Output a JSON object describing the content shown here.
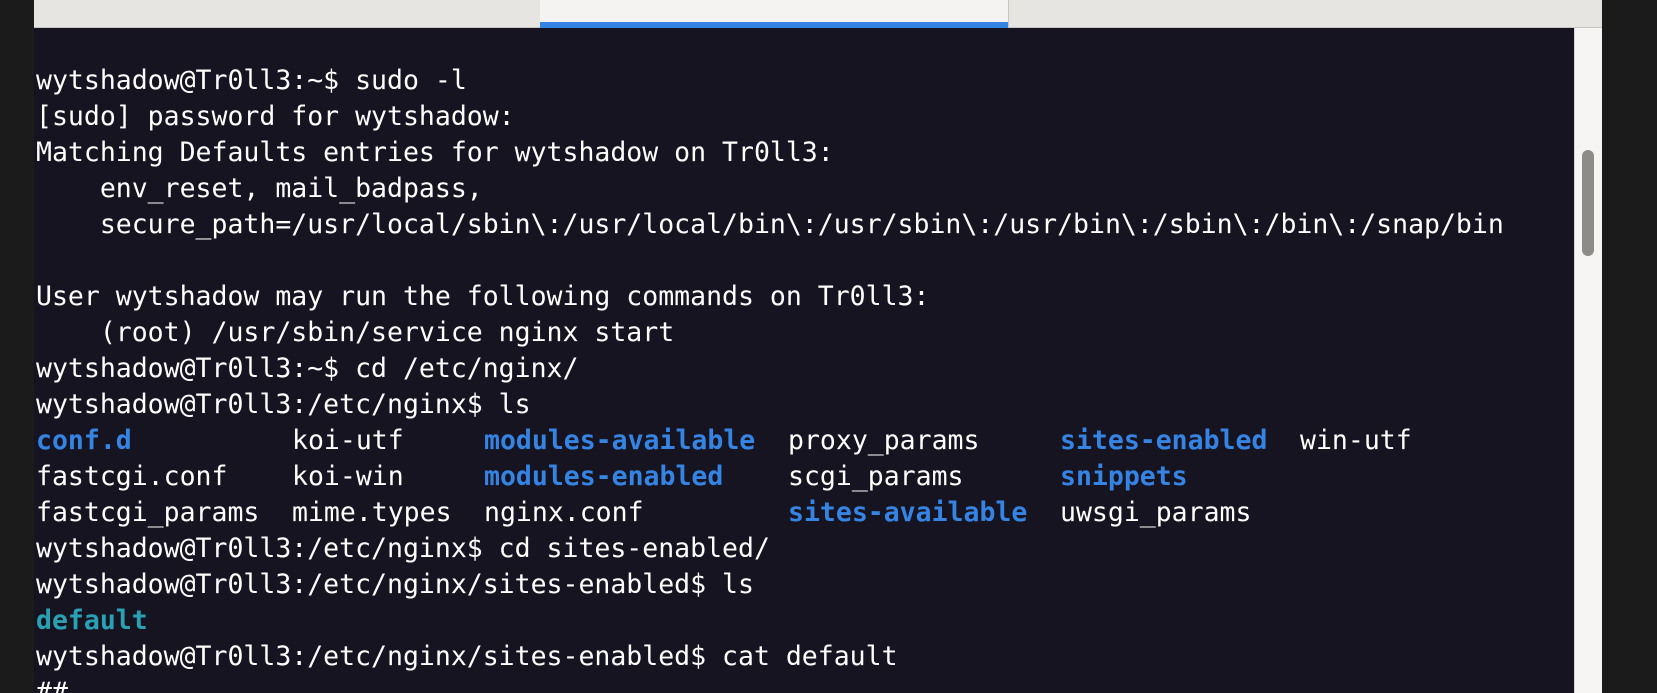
{
  "tabs": [
    {
      "label": "",
      "active": false
    },
    {
      "label": "",
      "active": true
    },
    {
      "label": "",
      "active": false
    }
  ],
  "colors": {
    "terminal_bg": "#171421",
    "text": "#ffffff",
    "directory": "#3584e4",
    "symlink": "#2aa1b3",
    "active_tab_indicator": "#3584e4"
  },
  "terminal": {
    "lines_before_ls": [
      "wytshadow@Tr0ll3:~$ sudo -l",
      "[sudo] password for wytshadow:",
      "Matching Defaults entries for wytshadow on Tr0ll3:",
      "    env_reset, mail_badpass,",
      "    secure_path=/usr/local/sbin\\:/usr/local/bin\\:/usr/sbin\\:/usr/bin\\:/sbin\\:/bin\\:/snap/bin",
      "",
      "User wytshadow may run the following commands on Tr0ll3:",
      "    (root) /usr/sbin/service nginx start",
      "wytshadow@Tr0ll3:~$ cd /etc/nginx/",
      "wytshadow@Tr0ll3:/etc/nginx$ ls"
    ],
    "ls_output": [
      [
        {
          "text": "conf.d",
          "type": "dir"
        },
        {
          "text": "koi-utf",
          "type": "file"
        },
        {
          "text": "modules-available",
          "type": "dir"
        },
        {
          "text": "proxy_params",
          "type": "file"
        },
        {
          "text": "sites-enabled",
          "type": "dir"
        },
        {
          "text": "win-utf",
          "type": "file"
        }
      ],
      [
        {
          "text": "fastcgi.conf",
          "type": "file"
        },
        {
          "text": "koi-win",
          "type": "file"
        },
        {
          "text": "modules-enabled",
          "type": "dir"
        },
        {
          "text": "scgi_params",
          "type": "file"
        },
        {
          "text": "snippets",
          "type": "dir"
        },
        {
          "text": "",
          "type": "file"
        }
      ],
      [
        {
          "text": "fastcgi_params",
          "type": "file"
        },
        {
          "text": "mime.types",
          "type": "file"
        },
        {
          "text": "nginx.conf",
          "type": "file"
        },
        {
          "text": "sites-available",
          "type": "dir"
        },
        {
          "text": "uwsgi_params",
          "type": "file"
        },
        {
          "text": "",
          "type": "file"
        }
      ]
    ],
    "line_cd_sites": "wytshadow@Tr0ll3:/etc/nginx$ cd sites-enabled/",
    "line_ls_sites": "wytshadow@Tr0ll3:/etc/nginx/sites-enabled$ ls",
    "sites_ls_output": "default",
    "line_cat": "wytshadow@Tr0ll3:/etc/nginx/sites-enabled$ cat default",
    "line_partial": "##"
  }
}
